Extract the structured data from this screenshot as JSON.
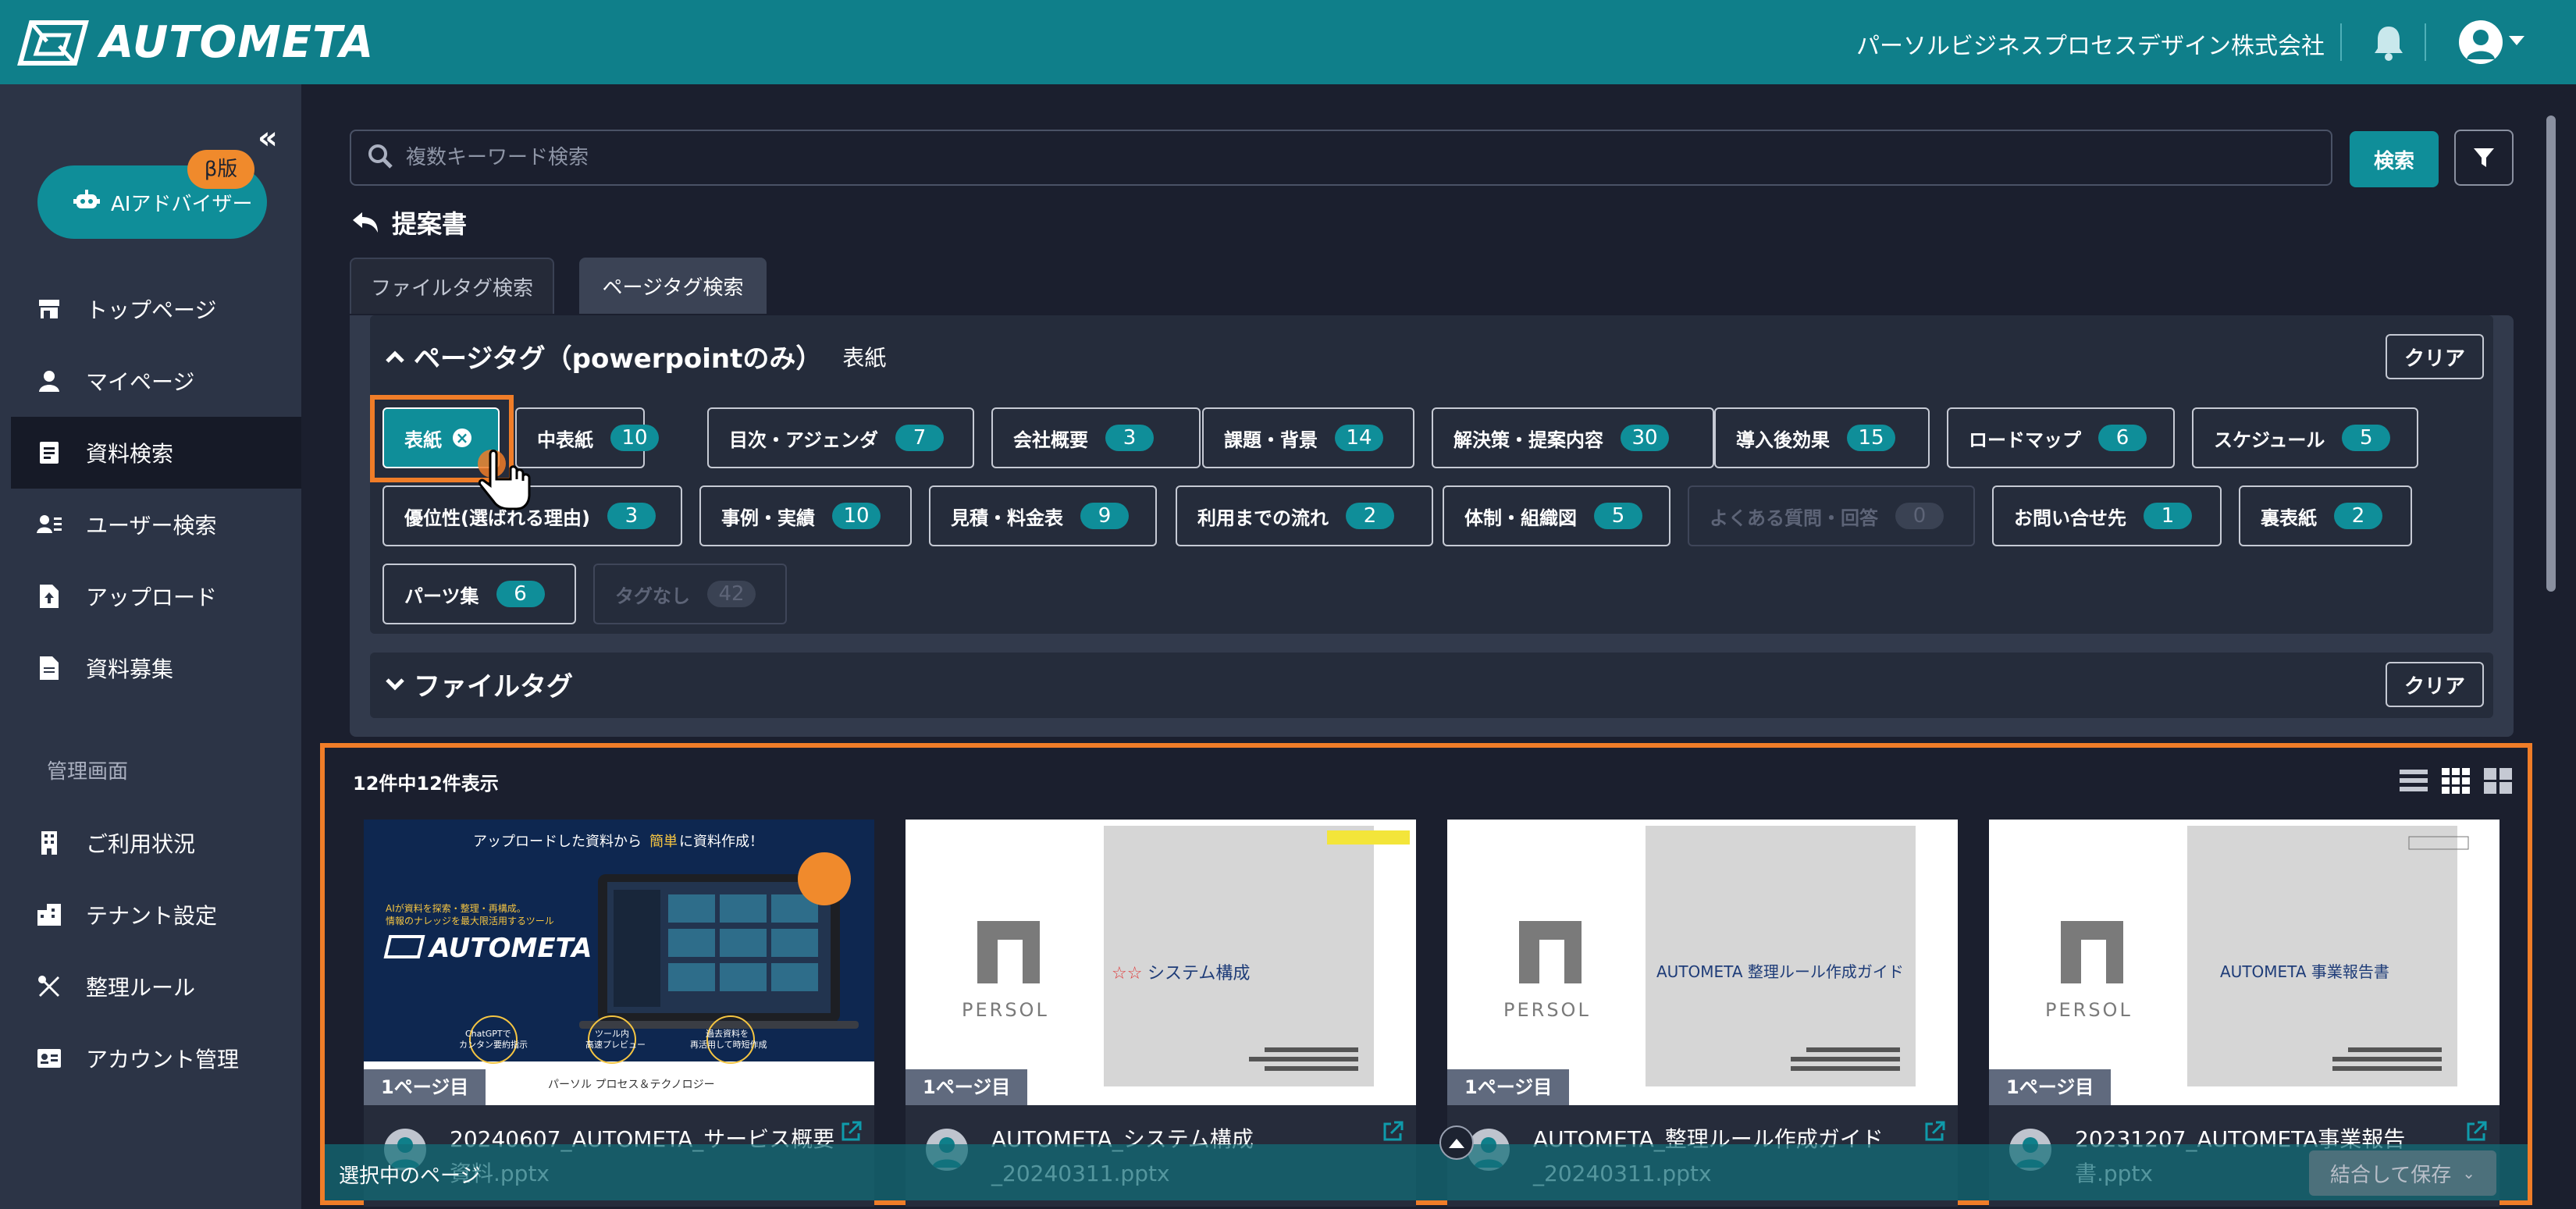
{
  "app": {
    "logo_text": "AUTOMETA",
    "company": "パーソルビジネスプロセスデザイン株式会社"
  },
  "colors": {
    "teal": "#0f7f8a",
    "accent": "#0f8e99",
    "highlight": "#f07d28",
    "sidebar": "#2c3446",
    "background": "#1b1f2e"
  },
  "sidebar": {
    "ai_button": "AIアドバイザー",
    "beta_badge": "β版",
    "items": [
      {
        "label": "トップページ",
        "icon": "store-icon"
      },
      {
        "label": "マイページ",
        "icon": "user-icon"
      },
      {
        "label": "資料検索",
        "icon": "document-search-icon",
        "active": true
      },
      {
        "label": "ユーザー検索",
        "icon": "user-search-icon"
      },
      {
        "label": "アップロード",
        "icon": "upload-file-icon"
      },
      {
        "label": "資料募集",
        "icon": "document-icon"
      }
    ],
    "admin_section": "管理画面",
    "admin_items": [
      {
        "label": "ご利用状況",
        "icon": "building-icon"
      },
      {
        "label": "テナント設定",
        "icon": "tenant-icon"
      },
      {
        "label": "整理ルール",
        "icon": "tools-icon"
      },
      {
        "label": "アカウント管理",
        "icon": "id-card-icon"
      }
    ]
  },
  "search": {
    "placeholder": "複数キーワード検索",
    "button": "検索"
  },
  "page": {
    "title": "提案書"
  },
  "tabs": [
    "ファイルタグ検索",
    "ページタグ検索"
  ],
  "page_tags": {
    "heading": "ページタグ（powerpointのみ）",
    "selected": "表紙",
    "clear": "クリア",
    "tags": [
      {
        "label": "表紙",
        "count": "",
        "selected": true
      },
      {
        "label": "中表紙",
        "count": "10"
      },
      {
        "label": "目次・アジェンダ",
        "count": "7"
      },
      {
        "label": "会社概要",
        "count": "3"
      },
      {
        "label": "課題・背景",
        "count": "14"
      },
      {
        "label": "解決策・提案内容",
        "count": "30"
      },
      {
        "label": "導入後効果",
        "count": "15"
      },
      {
        "label": "ロードマップ",
        "count": "6"
      },
      {
        "label": "スケジュール",
        "count": "5"
      },
      {
        "label": "優位性(選ばれる理由)",
        "count": "3"
      },
      {
        "label": "事例・実績",
        "count": "10"
      },
      {
        "label": "見積・料金表",
        "count": "9"
      },
      {
        "label": "利用までの流れ",
        "count": "2"
      },
      {
        "label": "体制・組織図",
        "count": "5"
      },
      {
        "label": "よくある質問・回答",
        "count": "0",
        "disabled": true
      },
      {
        "label": "お問い合せ先",
        "count": "1"
      },
      {
        "label": "裏表紙",
        "count": "2"
      },
      {
        "label": "パーツ集",
        "count": "6"
      },
      {
        "label": "タグなし",
        "count": "42",
        "disabled": true
      }
    ]
  },
  "file_tags": {
    "heading": "ファイルタグ",
    "clear": "クリア"
  },
  "results": {
    "count_label": "12件中12件表示",
    "cards": [
      {
        "page": "1ページ目",
        "title": "20240607_AUTOMETA_サービス概要資料.pptx",
        "thumb": {
          "headline": "アップロードした資料から",
          "headline_em": "簡単",
          "headline_tail": "に資料作成！",
          "sub1": "AIが資料を探索・整理・再構成。",
          "sub2": "情報のナレッジを最大限活用するツール",
          "logo": "AUTOMETA",
          "b1": "ChatGPTで",
          "b2": "カンタン要約指示",
          "b3": "ツール内",
          "b4": "高速プレビュー",
          "b5": "過去資料を",
          "b6": "再活用して時短作成",
          "footer": "パーソル プロセス＆テクノロジー"
        }
      },
      {
        "page": "1ページ目",
        "title": "AUTOMETA_システム構成_20240311.pptx",
        "thumb": {
          "stars": "☆☆",
          "title": "システム構成",
          "brand": "PERSOL"
        }
      },
      {
        "page": "1ページ目",
        "title": "AUTOMETA_整理ルール作成ガイド_20240311.pptx",
        "thumb": {
          "title": "AUTOMETA 整理ルール作成ガイド",
          "brand": "PERSOL"
        }
      },
      {
        "page": "1ページ目",
        "title": "20231207_AUTOMETA事業報告書.pptx",
        "thumb": {
          "title": "AUTOMETA 事業報告書",
          "brand": "PERSOL"
        }
      }
    ]
  },
  "bottom_bar": {
    "label": "選択中のページ",
    "save": "結合して保存"
  }
}
